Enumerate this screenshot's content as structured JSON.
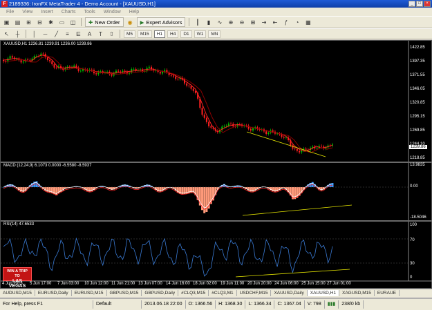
{
  "window": {
    "title": "2189336: IronFX MetaTrader 4 - Demo Account - [XAUUSD,H1]"
  },
  "menu": [
    "File",
    "View",
    "Insert",
    "Charts",
    "Tools",
    "Window",
    "Help"
  ],
  "toolbar": {
    "new_order": "New Order",
    "expert_advisors": "Expert Advisors"
  },
  "timeframes": [
    "M5",
    "M15",
    "H1",
    "H4",
    "D1",
    "W1",
    "MN"
  ],
  "active_timeframe": "H1",
  "main_pane": {
    "label": "XAUUSD,H1  1236.81 1239.91 1236.00 1239.86",
    "y_ticks": [
      "1422.85",
      "1397.35",
      "1371.55",
      "1346.05",
      "1320.85",
      "1295.15",
      "1269.85",
      "1244.10",
      "1218.85"
    ],
    "current_price": "1239.86"
  },
  "macd_pane": {
    "label": "MACD (12,24,9) 6.1073 0.0000 -6.5580 -8.5937",
    "y_ticks": [
      "13.9835",
      "0.00",
      "-18.5046"
    ]
  },
  "rsi_pane": {
    "label": "RSI(14) 47.6533",
    "y_ticks": [
      "100",
      "70",
      "30",
      "0"
    ]
  },
  "x_ticks": [
    "4 Jun 2013",
    "5 Jun 17:00",
    "7 Jun 03:00",
    "10 Jun 12:00",
    "11 Jun 21:00",
    "13 Jun 07:00",
    "14 Jun 16:00",
    "18 Jun 02:00",
    "19 Jun 11:00",
    "20 Jun 20:00",
    "24 Jun 06:00",
    "25 Jun 15:00",
    "27 Jun 01:00"
  ],
  "ad_banner": {
    "line1": "WIN A TRIP TO",
    "line2": "LAS VEGAS"
  },
  "tabs": [
    "AUDUSD,M15",
    "EURUSD,Daily",
    "EURUSD,M15",
    "GBPUSD,M15",
    "GBPUSD,Daily",
    "#CLQ3,M15",
    "#CLQ3,M1",
    "USDCHF,M15",
    "XAUUSD,Daily",
    "XAUUSD,H1",
    "XAGUSD,M15",
    "EURAUE"
  ],
  "active_tab": "XAUUSD,H1",
  "status": {
    "help": "For Help, press F1",
    "profile": "Default",
    "datetime": "2013.06.18 22:00",
    "open": "O: 1366.56",
    "high": "H: 1368.30",
    "low": "L: 1366.34",
    "close": "C: 1367.04",
    "volume": "V: 798",
    "traffic": "238/0 kb"
  },
  "colors": {
    "up_candle": "#00c000",
    "down_candle": "#ff2020",
    "macd_hist_pos": "#3399ff",
    "macd_hist_neg": "#ff9a7a",
    "trendline": "#e6e600",
    "rsi_line": "#3a7bd5"
  }
}
